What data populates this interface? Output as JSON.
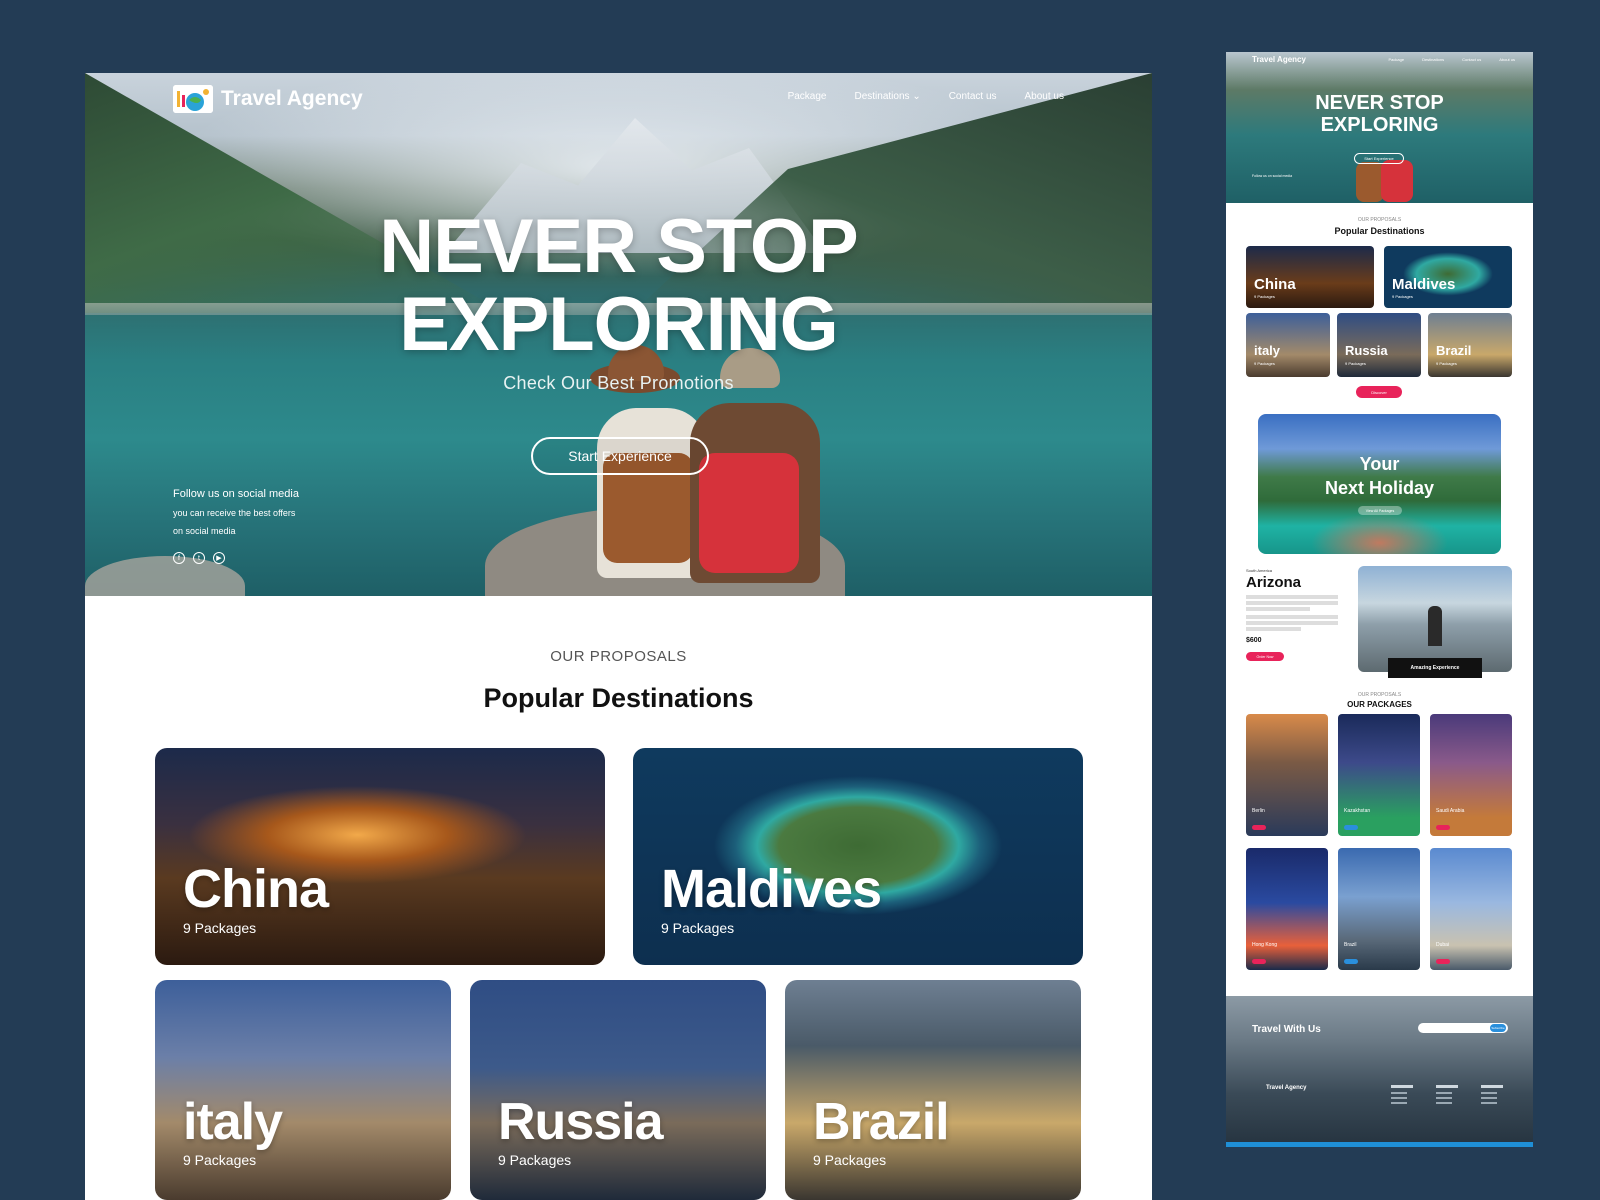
{
  "brand": {
    "name": "Travel Agency"
  },
  "nav": {
    "items": [
      {
        "label": "Package"
      },
      {
        "label": "Destinations"
      },
      {
        "label": "Contact us"
      },
      {
        "label": "About us"
      }
    ]
  },
  "hero": {
    "title_line1": "NEVER STOP",
    "title_line2": "EXPLORING",
    "subtitle": "Check Our Best Promotions",
    "cta": "Start Experience",
    "social": {
      "line1": "Follow us on social media",
      "line2": "you can receive the best offers",
      "line3": "on social media",
      "icons": [
        "facebook-icon",
        "twitter-icon",
        "youtube-icon"
      ]
    }
  },
  "section": {
    "eyebrow": "OUR PROPOSALS",
    "title": "Popular Destinations"
  },
  "destinations": [
    {
      "name": "China",
      "packages": "9 Packages"
    },
    {
      "name": "Maldives",
      "packages": "9 Packages"
    },
    {
      "name": "italy",
      "packages": "9 Packages"
    },
    {
      "name": "Russia",
      "packages": "9 Packages"
    },
    {
      "name": "Brazil",
      "packages": "9 Packages"
    }
  ],
  "preview": {
    "title_line1": "NEVER STOP",
    "title_line2": "EXPLORING",
    "cta": "Start Experience",
    "eyebrow": "OUR PROPOSALS",
    "section_title": "Popular Destinations",
    "discover": "Discover",
    "holiday": {
      "line1": "Your",
      "line2": "Next Holiday",
      "cta": "View All Packages"
    },
    "arizona": {
      "region": "South America",
      "title": "Arizona",
      "price": "$600",
      "cta": "Order Now",
      "tag": "Amazing Experience"
    },
    "packages_eyebrow": "OUR PROPOSALS",
    "packages_title": "OUR PACKAGES",
    "packages": [
      {
        "city": "Berlin"
      },
      {
        "city": "Kazakhstan"
      },
      {
        "city": "Saudi Arabia"
      },
      {
        "city": "Hong Kong"
      },
      {
        "city": "Brazil"
      },
      {
        "city": "Dubai"
      }
    ],
    "footer": {
      "title": "Travel With Us",
      "subscribe": "Subscribe",
      "brand": "Travel Agency"
    }
  },
  "colors": {
    "page_bg": "#233c55",
    "accent": "#e8235a",
    "footer_bar": "#1f8fd6"
  }
}
